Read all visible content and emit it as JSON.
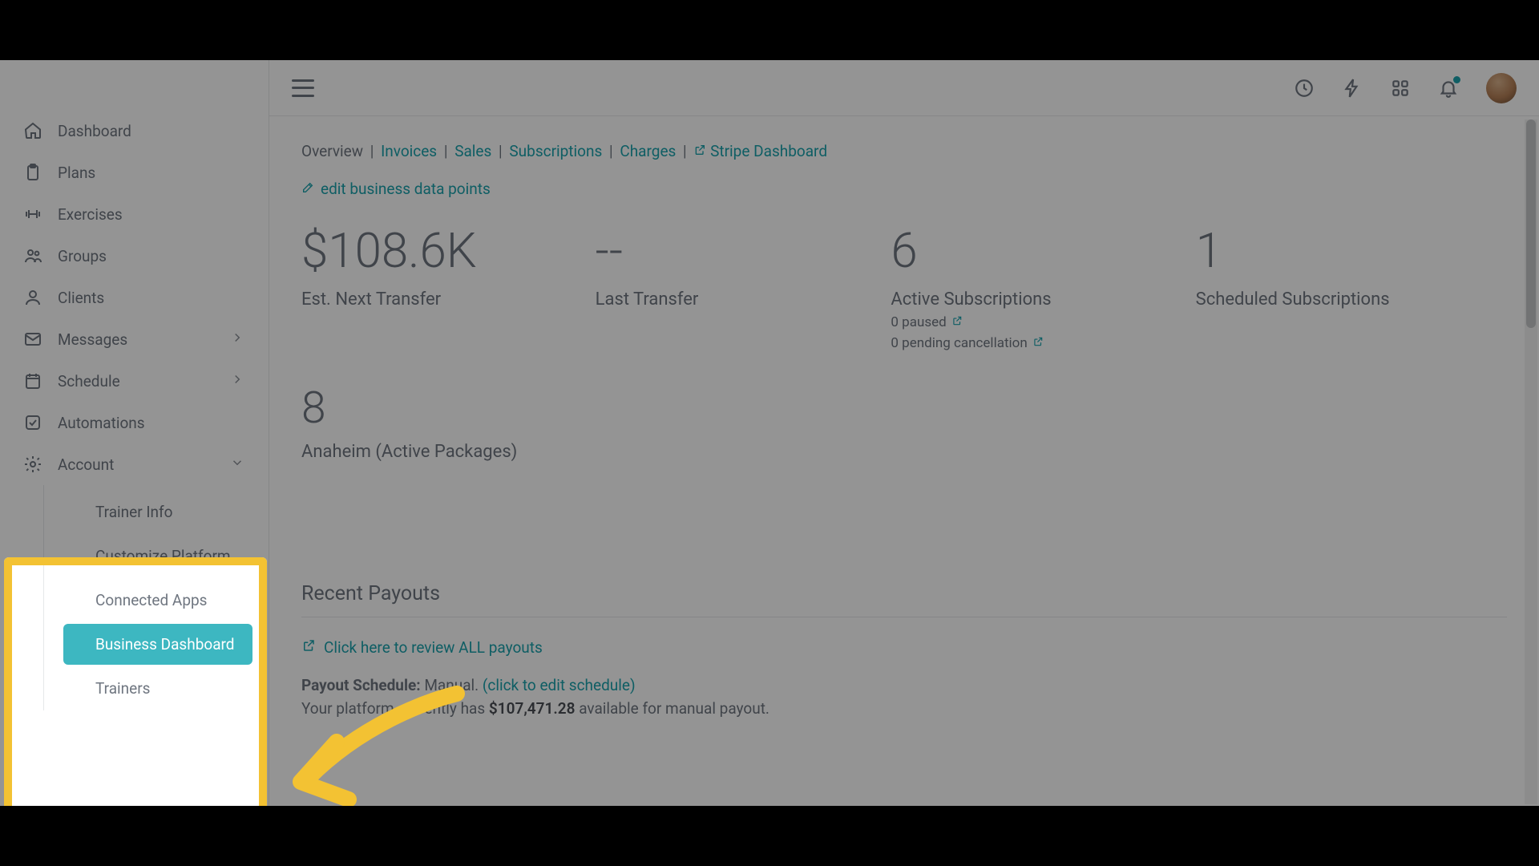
{
  "sidebar": {
    "items": [
      {
        "label": "Dashboard"
      },
      {
        "label": "Plans"
      },
      {
        "label": "Exercises"
      },
      {
        "label": "Groups"
      },
      {
        "label": "Clients"
      },
      {
        "label": "Messages"
      },
      {
        "label": "Schedule"
      },
      {
        "label": "Automations"
      },
      {
        "label": "Account"
      }
    ],
    "account_sub": [
      {
        "label": "Trainer Info"
      },
      {
        "label": "Customize Platform"
      },
      {
        "label": "Connected Apps"
      },
      {
        "label": "Business Dashboard"
      },
      {
        "label": "Trainers"
      }
    ]
  },
  "breadcrumb": {
    "overview": "Overview",
    "invoices": "Invoices",
    "sales": "Sales",
    "subscriptions": "Subscriptions",
    "charges": "Charges",
    "stripe": "Stripe Dashboard"
  },
  "edit_link": "edit business data points",
  "metrics": {
    "next_transfer": {
      "value": "$108.6K",
      "label": "Est. Next Transfer"
    },
    "last_transfer": {
      "value": "--",
      "label": "Last Transfer"
    },
    "active_subs": {
      "value": "6",
      "label": "Active Subscriptions",
      "paused": "0 paused",
      "pending": "0 pending cancellation"
    },
    "scheduled_subs": {
      "value": "1",
      "label": "Scheduled Subscriptions"
    }
  },
  "packages": {
    "value": "8",
    "label": "Anaheim (Active Packages)"
  },
  "recent_payouts": {
    "title": "Recent Payouts",
    "review_link": "Click here to review ALL payouts",
    "schedule_label": "Payout Schedule:",
    "schedule_value": "Manual.",
    "schedule_click": "(click to edit schedule)",
    "available_prefix": "Your platform currently has ",
    "available_amount": "$107,471.28",
    "available_suffix": " available for manual payout."
  }
}
